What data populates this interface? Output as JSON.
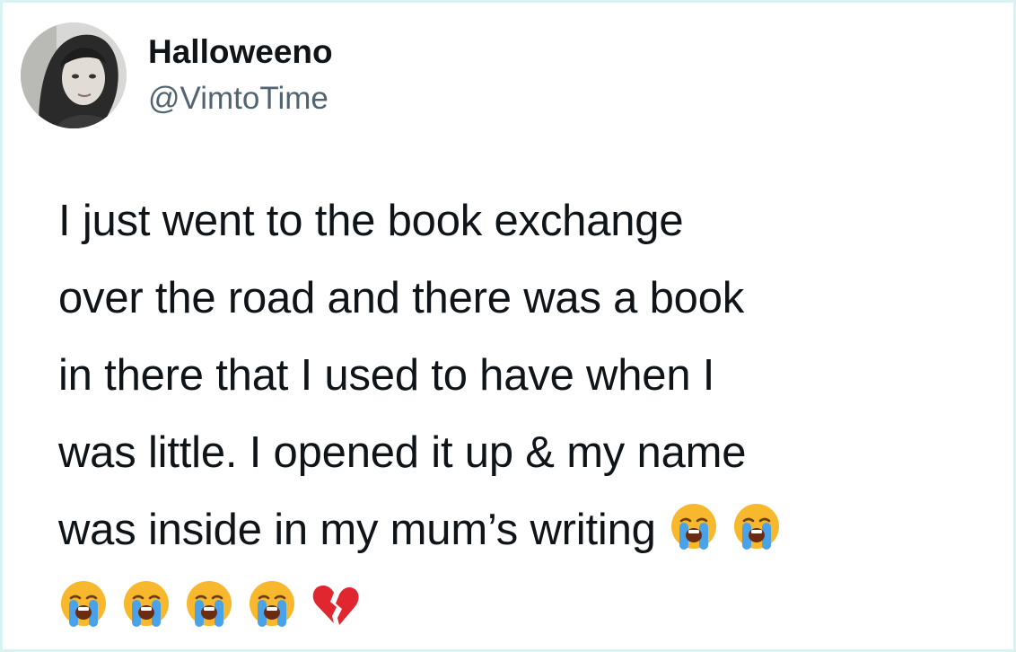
{
  "tweet": {
    "display_name": "Halloweeno",
    "handle": "@VimtoTime",
    "lines": [
      "I just went to the book exchange",
      "over the road and there was a book",
      "in there that I used to have when I",
      "was little. I opened it up & my name",
      "was inside in my mum’s writing"
    ],
    "trailing_emojis_line5": [
      "😭",
      "😭"
    ],
    "emoji_row": [
      "😭",
      "😭",
      "😭",
      "😭",
      "💔"
    ],
    "emoji_names": {
      "😭": "loudly-crying-face-icon",
      "💔": "broken-heart-icon"
    }
  },
  "colors": {
    "text": "#0f1419",
    "handle": "#536471",
    "border": "#d9f3f3",
    "emoji_face": "#f7b82d",
    "emoji_tears": "#4aa3e8",
    "heart": "#e0262f"
  }
}
